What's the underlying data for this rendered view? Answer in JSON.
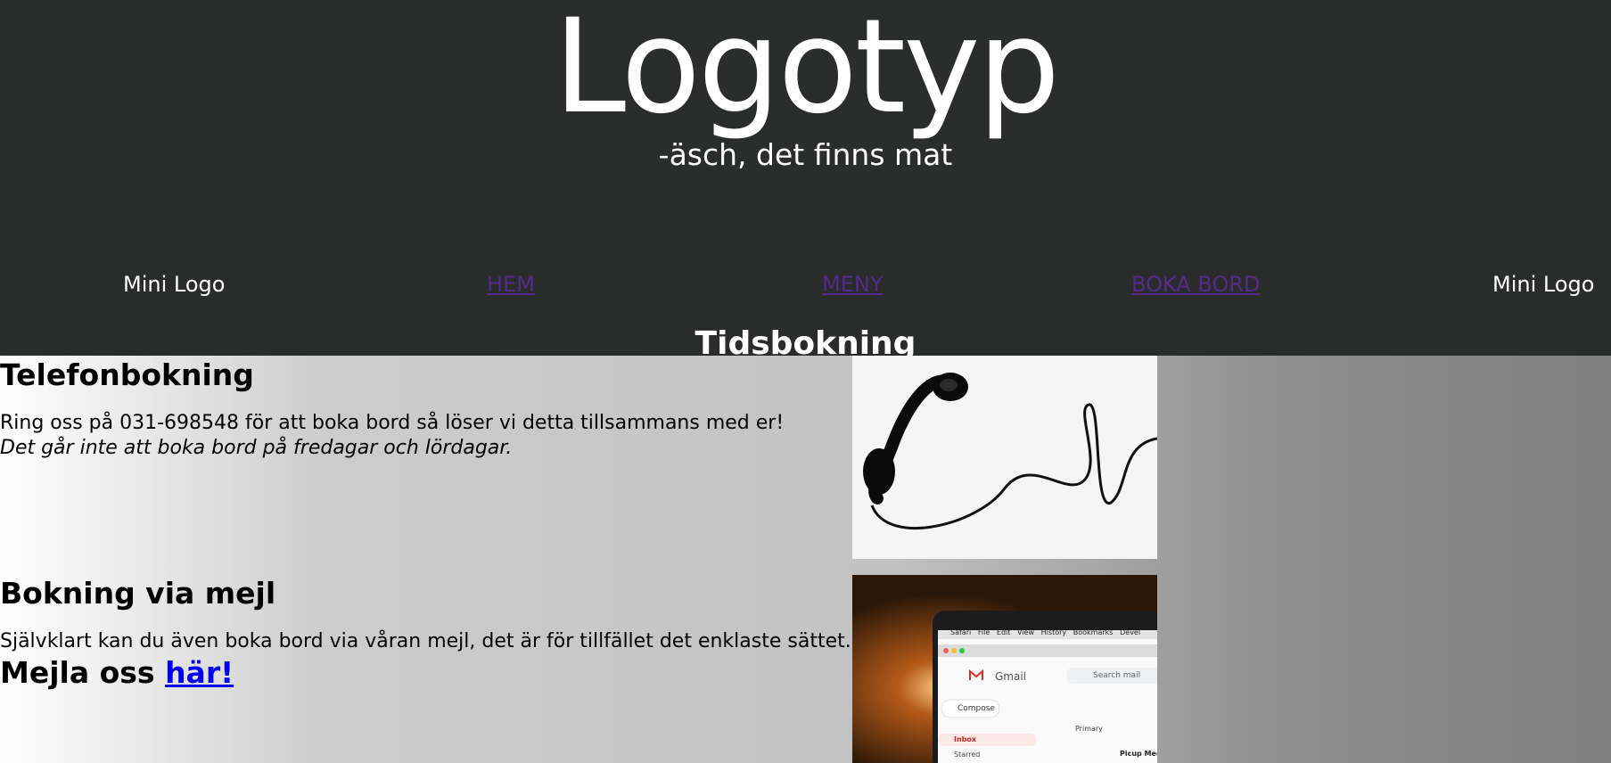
{
  "header": {
    "logo": "Logotyp",
    "tagline": "-äsch, det finns mat"
  },
  "nav": {
    "left_logo": "Mini Logo",
    "links": [
      "HEM",
      "MENY",
      "BOKA BORD"
    ],
    "right_logo": "Mini Logo"
  },
  "page_title": "Tidsbokning",
  "phone_section": {
    "heading": "Telefonbokning",
    "text": "Ring oss på 031-698548 för att boka bord så löser vi detta tillsammans med er!",
    "note": "Det går inte att boka bord på fredagar och lördagar."
  },
  "mail_section": {
    "heading": "Bokning via mejl",
    "text": "Självklart kan du även boka bord via våran mejl, det är för tillfället det enklaste sättet.",
    "cta_prefix": "Mejla oss",
    "cta_link": "här!"
  },
  "laptop_screen": {
    "menubar": [
      "Safari",
      "File",
      "Edit",
      "View",
      "History",
      "Bookmarks",
      "Devel"
    ],
    "app": "Gmail",
    "search_placeholder": "Search mail",
    "compose": "Compose",
    "inbox": "Inbox",
    "starred": "Starred",
    "primary": "Primary",
    "row_sender": "Picup Medi"
  },
  "colors": {
    "header_bg": "#2b2d2d",
    "nav_bg": "#2a2b2b",
    "visited_link": "#552b8a",
    "link": "#0000ee"
  }
}
